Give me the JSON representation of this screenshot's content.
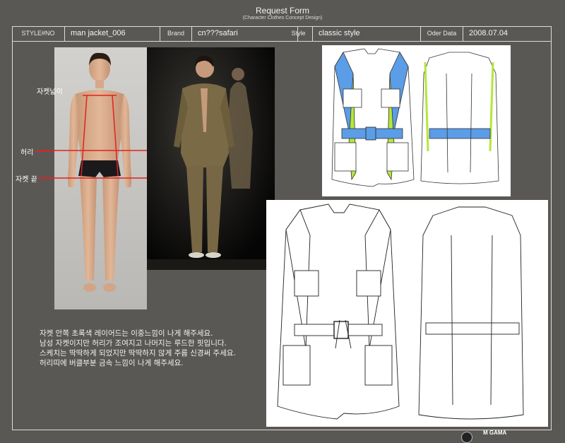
{
  "header": {
    "title": "Request Form",
    "subtitle": "(Character Clothes Concept Design)"
  },
  "info": {
    "style_label": "STYLE#NO",
    "style_value": "man jacket_006",
    "brand_label": "Brand",
    "brand_value": "cn???safari",
    "style2_label": "Style",
    "style2_value": "classic style",
    "order_label": "Oder Data",
    "order_value": "2008.07.04"
  },
  "body_annotations": {
    "jacket_width": "자켓넓이",
    "waist": "허리",
    "jacket_end": "자켓 끝"
  },
  "notes": [
    "자켓 안쪽 초록색 레이어드는 이중느낌이 나게 해주세요.",
    "남성 자켓이지만 허리가 조여지고 나머지는 루드한 핏입니다.",
    "스케치는 딱딱하게 되었지만 딱딱하지 않게 주름 신경써 주세요.",
    "허리띠에 버클부분 금속 느낌이 나게 해주세요."
  ],
  "footer": {
    "brand": "M GAMA"
  },
  "colors": {
    "background": "#5a5855",
    "lapel_blue": "#5b9de6",
    "layer_green": "#b6e63a",
    "guide_red": "#e0221f",
    "jacket_khaki": "#7a6a45"
  }
}
